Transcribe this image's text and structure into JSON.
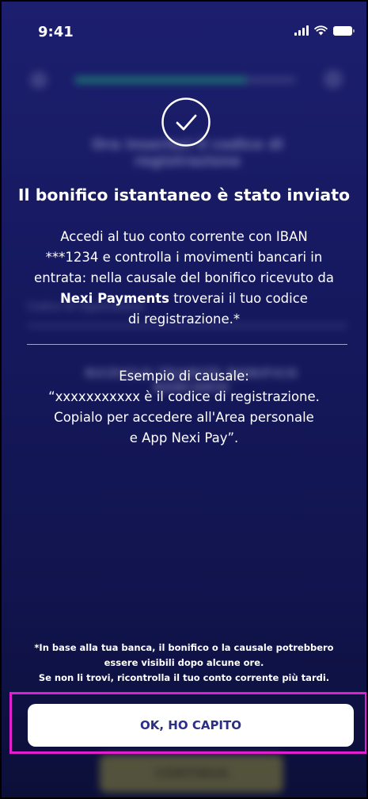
{
  "status_bar": {
    "time": "9:41",
    "icons": [
      "signal-icon",
      "wifi-icon",
      "battery-icon"
    ]
  },
  "background_screen": {
    "header": {
      "back_icon": "back-arrow-icon",
      "help_icon": "help-icon"
    },
    "title": "Ora inserisci il codice di registrazione",
    "field_label": "Codice di registrazione",
    "link_label": "RICEVILO TRAMITE BONIFICO BANCARIO",
    "continue_label": "CONTINUA",
    "progress_percent": 78,
    "progress_color": "#1fc57a"
  },
  "modal": {
    "icon": "check-circle-icon",
    "title": "Il bonifico istantaneo è stato inviato",
    "body": {
      "line1": "Accedi al tuo conto corrente con IBAN",
      "line2": "***1234 e controlla i movimenti bancari in",
      "line3": "entrata: nella causale del bonifico ricevuto da",
      "line4_bold": "Nexi Payments",
      "line4_rest": " troverai il tuo codice",
      "line5": "di registrazione.*"
    },
    "example": {
      "heading": "Esempio di causale:",
      "line1": "“xxxxxxxxxxx è il codice di registrazione.",
      "line2": "Copialo per accedere all'Area personale",
      "line3": "e App Nexi Pay”."
    },
    "footnote": {
      "line1": "*In base alla tua banca, il bonifico o la causale potrebbero",
      "line2": "essere visibili dopo alcune ore.",
      "line3": "Se non li trovi, ricontrolla il tuo conto corrente più tardi."
    },
    "ok_button_label": "OK, HO CAPITO"
  },
  "colors": {
    "background": "#1c1f6e",
    "button_text": "#2b2f86",
    "highlight": "#e21fd0"
  }
}
